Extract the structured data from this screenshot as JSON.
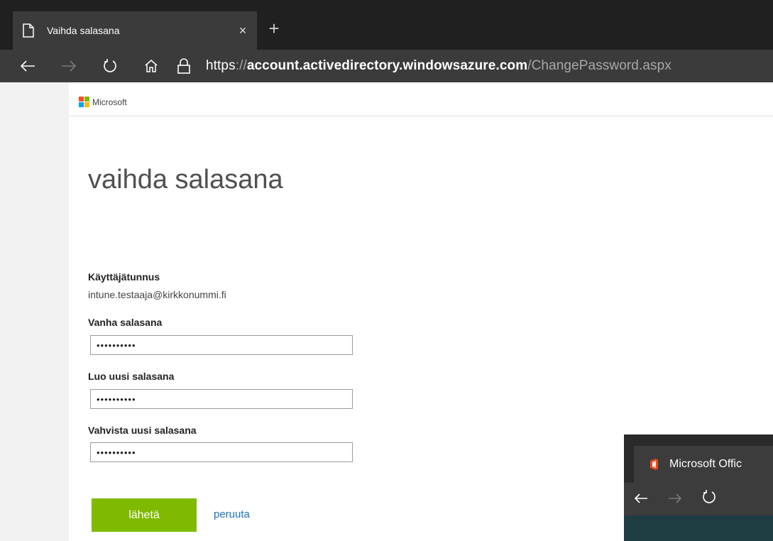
{
  "browser": {
    "tab_title": "Vaihda salasana",
    "tab_close": "×",
    "new_tab": "+",
    "url": {
      "scheme": "https",
      "separator": "://",
      "host": "account.activedirectory.windowsazure.com",
      "path": "/ChangePassword.aspx"
    },
    "icons": [
      "back-arrow-icon",
      "forward-arrow-icon",
      "refresh-icon",
      "home-icon",
      "lock-icon",
      "page-icon"
    ]
  },
  "page": {
    "brand": "Microsoft",
    "brand_colors": [
      "#f25022",
      "#7fba00",
      "#00a4ef",
      "#ffb900"
    ],
    "title": "vaihda salasana",
    "username_label": "Käyttäjätunnus",
    "username_value": "intune.testaaja@kirkkonummi.fi",
    "old_password_label": "Vanha salasana",
    "old_password_value": "••••••••••",
    "new_password_label": "Luo uusi salasana",
    "new_password_value": "••••••••••",
    "confirm_password_label": "Vahvista uusi salasana",
    "confirm_password_value": "••••••••••",
    "submit_label": "lähetä",
    "cancel_label": "peruuta",
    "accent_color": "#7fba00",
    "link_color": "#1f70b8"
  },
  "second_window": {
    "tab_title": "Microsoft Offic",
    "icons": [
      "office-icon",
      "back-arrow-icon",
      "forward-arrow-icon",
      "refresh-icon"
    ]
  }
}
